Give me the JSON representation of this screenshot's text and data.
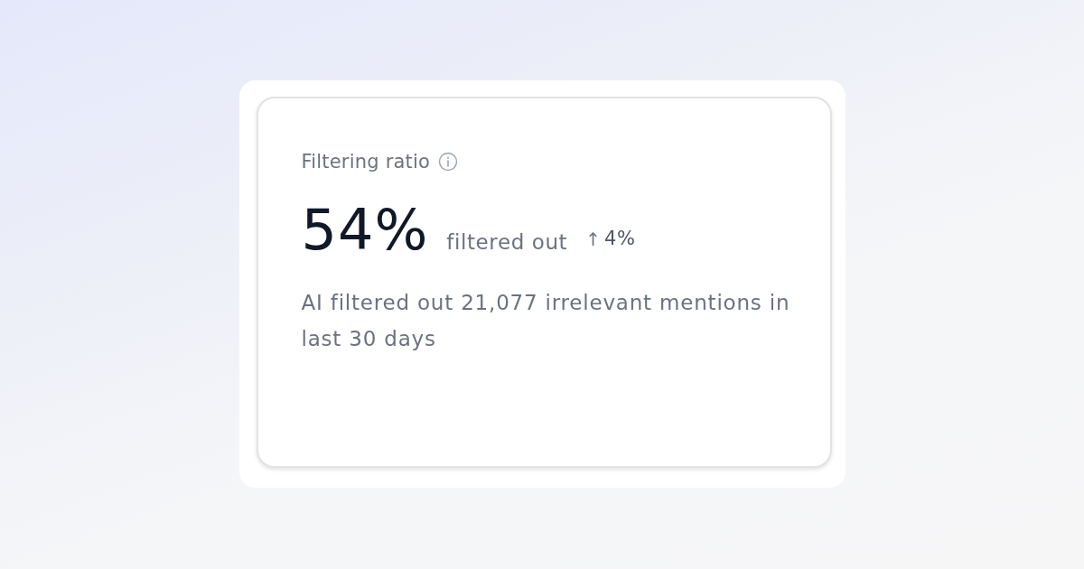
{
  "card": {
    "title": "Filtering ratio",
    "value": "54%",
    "value_caption": "filtered out",
    "change": {
      "arrow": "↑",
      "value": "4%"
    },
    "description": "AI filtered out 21,077 irrelevant mentions in last 30 days"
  }
}
